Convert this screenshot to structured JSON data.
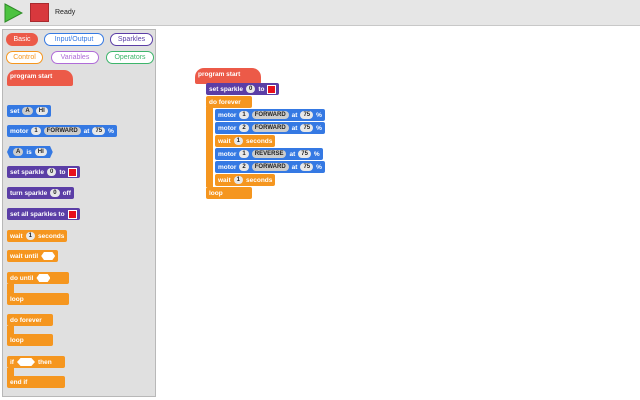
{
  "toolbar": {
    "run_icon": "play-icon",
    "stop_icon": "stop-icon",
    "status": "Ready"
  },
  "palette": {
    "tabs": [
      {
        "label": "Basic",
        "color": "#ec5a48",
        "selected": true
      },
      {
        "label": "Input/Output",
        "color": "#3579e3",
        "selected": false
      },
      {
        "label": "Sparkles",
        "color": "#5b3ea6",
        "selected": false
      },
      {
        "label": "Control",
        "color": "#f5961f",
        "selected": false
      },
      {
        "label": "Variables",
        "color": "#b06cd8",
        "selected": false
      },
      {
        "label": "Operators",
        "color": "#3db56b",
        "selected": false
      }
    ],
    "blocks": {
      "program_start": "program start",
      "set": "set",
      "set_var": "A",
      "set_val": "HI",
      "motor": "motor",
      "motor_num": "1",
      "motor_dir": "FORWARD",
      "at": "at",
      "motor_speed": "75",
      "percent": "%",
      "is_a": "A",
      "is": "is",
      "is_val": "HI",
      "set_sparkle": "set sparkle",
      "sparkle_num": "0",
      "to": "to",
      "turn_sparkle": "turn sparkle",
      "turn_num": "0",
      "off": "off",
      "set_all_sparkles": "set all sparkles to",
      "wait": "wait",
      "wait_num": "1",
      "seconds": "seconds",
      "wait_until": "wait until",
      "do_until": "do until",
      "loop": "loop",
      "do_forever": "do forever",
      "loop2": "loop",
      "if": "if",
      "then": "then",
      "end_if": "end if"
    }
  },
  "workspace": {
    "program_start": "program start",
    "set_sparkle": "set sparkle",
    "sparkle_num": "0",
    "to": "to",
    "do_forever": "do forever",
    "loop": "loop",
    "steps": [
      {
        "type": "motor",
        "label": "motor",
        "num": "1",
        "dir": "FORWARD",
        "at": "at",
        "speed": "75",
        "unit": "%"
      },
      {
        "type": "motor",
        "label": "motor",
        "num": "2",
        "dir": "FORWARD",
        "at": "at",
        "speed": "75",
        "unit": "%"
      },
      {
        "type": "wait",
        "label": "wait",
        "num": "1",
        "unit": "seconds"
      },
      {
        "type": "motor",
        "label": "motor",
        "num": "1",
        "dir": "REVERSE",
        "at": "at",
        "speed": "75",
        "unit": "%"
      },
      {
        "type": "motor",
        "label": "motor",
        "num": "2",
        "dir": "FORWARD",
        "at": "at",
        "speed": "75",
        "unit": "%"
      },
      {
        "type": "wait",
        "label": "wait",
        "num": "1",
        "unit": "seconds"
      }
    ]
  }
}
